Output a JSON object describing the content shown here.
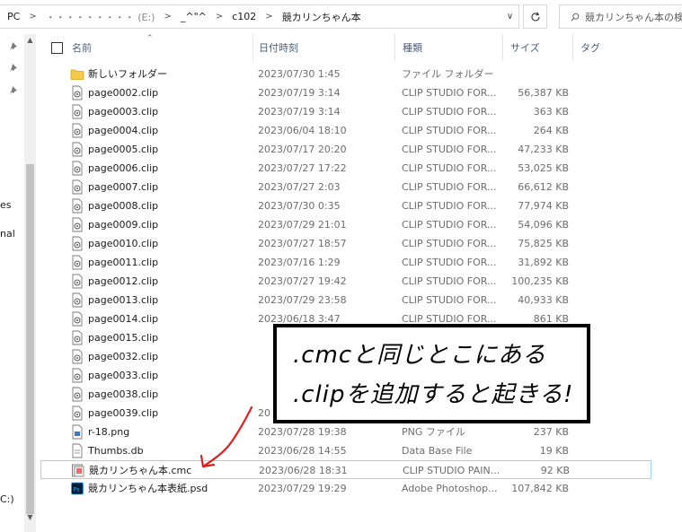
{
  "address": {
    "crumbs": [
      "PC",
      "・・・・・・・・・ (E:)",
      "_^\"^",
      "c102",
      "競カリンちゃん本"
    ],
    "dropdown_icon": "chevron-down-icon",
    "refresh_icon": "refresh-icon"
  },
  "search": {
    "placeholder": "競カリンちゃん本の検"
  },
  "nav": {
    "fragments": [
      "es",
      "nal",
      "C:)"
    ]
  },
  "columns": {
    "name": "名前",
    "date": "日付時刻",
    "type": "種類",
    "size": "サイズ",
    "tag": "タグ"
  },
  "files": [
    {
      "name": "新しいフォルダー",
      "date": "2023/07/30 1:45",
      "type": "ファイル フォルダー",
      "size": "",
      "icon": "folder-icon"
    },
    {
      "name": "page0002.clip",
      "date": "2023/07/19 3:14",
      "type": "CLIP STUDIO FOR...",
      "size": "56,387 KB",
      "icon": "clip-file-icon"
    },
    {
      "name": "page0003.clip",
      "date": "2023/07/19 3:14",
      "type": "CLIP STUDIO FOR...",
      "size": "363 KB",
      "icon": "clip-file-icon"
    },
    {
      "name": "page0004.clip",
      "date": "2023/06/04 18:10",
      "type": "CLIP STUDIO FOR...",
      "size": "264 KB",
      "icon": "clip-file-icon"
    },
    {
      "name": "page0005.clip",
      "date": "2023/07/17 20:20",
      "type": "CLIP STUDIO FOR...",
      "size": "47,233 KB",
      "icon": "clip-file-icon"
    },
    {
      "name": "page0006.clip",
      "date": "2023/07/27 17:22",
      "type": "CLIP STUDIO FOR...",
      "size": "53,025 KB",
      "icon": "clip-file-icon"
    },
    {
      "name": "page0007.clip",
      "date": "2023/07/27 2:03",
      "type": "CLIP STUDIO FOR...",
      "size": "66,612 KB",
      "icon": "clip-file-icon"
    },
    {
      "name": "page0008.clip",
      "date": "2023/07/30 0:35",
      "type": "CLIP STUDIO FOR...",
      "size": "77,974 KB",
      "icon": "clip-file-icon"
    },
    {
      "name": "page0009.clip",
      "date": "2023/07/29 21:01",
      "type": "CLIP STUDIO FOR...",
      "size": "54,096 KB",
      "icon": "clip-file-icon"
    },
    {
      "name": "page0010.clip",
      "date": "2023/07/27 18:57",
      "type": "CLIP STUDIO FOR...",
      "size": "75,825 KB",
      "icon": "clip-file-icon"
    },
    {
      "name": "page0011.clip",
      "date": "2023/07/16 1:29",
      "type": "CLIP STUDIO FOR...",
      "size": "31,892 KB",
      "icon": "clip-file-icon"
    },
    {
      "name": "page0012.clip",
      "date": "2023/07/27 19:42",
      "type": "CLIP STUDIO FOR...",
      "size": "100,235 KB",
      "icon": "clip-file-icon"
    },
    {
      "name": "page0013.clip",
      "date": "2023/07/29 23:58",
      "type": "CLIP STUDIO FOR...",
      "size": "40,933 KB",
      "icon": "clip-file-icon"
    },
    {
      "name": "page0014.clip",
      "date": "2023/06/18 3:47",
      "type": "CLIP STUDIO FOR...",
      "size": "861 KB",
      "icon": "clip-file-icon"
    },
    {
      "name": "page0015.clip",
      "date": "",
      "type": "",
      "size": "",
      "icon": "clip-file-icon"
    },
    {
      "name": "page0032.clip",
      "date": "",
      "type": "",
      "size": "",
      "icon": "clip-file-icon"
    },
    {
      "name": "page0033.clip",
      "date": "",
      "type": "",
      "size": "",
      "icon": "clip-file-icon"
    },
    {
      "name": "page0038.clip",
      "date": "",
      "type": "",
      "size": "",
      "icon": "clip-file-icon"
    },
    {
      "name": "page0039.clip",
      "date": "20",
      "type": "",
      "size": "",
      "icon": "clip-file-icon"
    },
    {
      "name": "r-18.png",
      "date": "2023/07/28 19:38",
      "type": "PNG ファイル",
      "size": "237 KB",
      "icon": "png-file-icon"
    },
    {
      "name": "Thumbs.db",
      "date": "2023/06/28 14:55",
      "type": "Data Base File",
      "size": "19 KB",
      "icon": "db-file-icon"
    },
    {
      "name": "競カリンちゃん本.cmc",
      "date": "2023/06/28 18:31",
      "type": "CLIP STUDIO PAIN...",
      "size": "92 KB",
      "icon": "cmc-file-icon",
      "selected": true
    },
    {
      "name": "競カリンちゃん本表紙.psd",
      "date": "2023/07/29 19:29",
      "type": "Adobe Photoshop...",
      "size": "107,842 KB",
      "icon": "psd-file-icon"
    }
  ],
  "annotation": {
    "line1": ".cmcと同じとこにある",
    "line2": ".clipを追加すると起きる!",
    "arrow_color": "#e02020"
  }
}
